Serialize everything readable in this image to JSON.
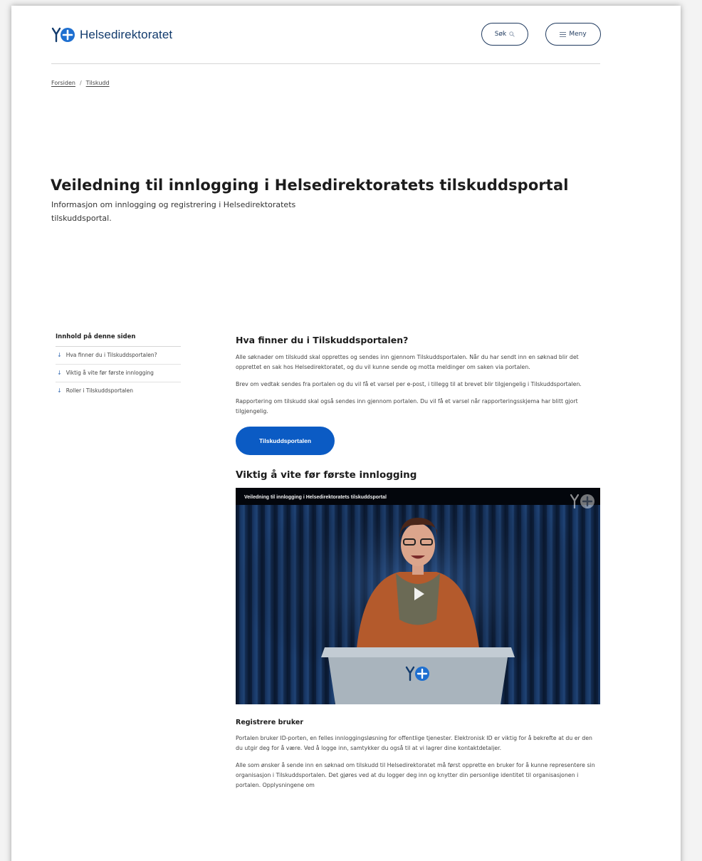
{
  "header": {
    "logo_text": "Helsedirektoratet",
    "search_label": "Søk",
    "menu_label": "Meny"
  },
  "breadcrumb": {
    "items": [
      "Forsiden",
      "Tilskudd"
    ],
    "separator": "/"
  },
  "page": {
    "title": "Veiledning til innlogging i Helsedirektoratets tilskuddsportal",
    "lead": "Informasjon om innlogging og registrering i Helsedirektoratets tilskuddsportal."
  },
  "toc": {
    "heading": "Innhold på denne siden",
    "items": [
      "Hva finner du i Tilskuddsportalen?",
      "Viktig å vite før første innlogging",
      "Roller i Tilskuddsportalen"
    ]
  },
  "section1": {
    "heading": "Hva finner du i Tilskuddsportalen?",
    "paragraphs": [
      "Alle søknader om tilskudd skal opprettes og sendes inn gjennom Tilskuddsportalen. Når du har sendt inn en søknad blir det opprettet en sak hos Helsedirektoratet, og du vil kunne sende og motta meldinger om saken via portalen.",
      "Brev om vedtak sendes fra portalen og du vil få et varsel per e-post, i tillegg til at brevet blir tilgjengelig i Tilskuddsportalen.",
      "Rapportering om tilskudd skal også sendes inn gjennom portalen. Du vil få et varsel når rapporteringsskjema har blitt gjort tilgjengelig."
    ],
    "button_label": "Tilskuddsportalen"
  },
  "section2": {
    "heading": "Viktig å vite før første innlogging",
    "video_title": "Veiledning til innlogging i Helsedirektoratets tilskuddsportal"
  },
  "section3": {
    "heading": "Registrere bruker",
    "paragraphs": [
      "Portalen bruker ID-porten, en felles innloggingsløsning for offentlige tjenester. Elektronisk ID er viktig for å bekrefte at du er den du utgir deg for å være. Ved å logge inn, samtykker du også til at vi lagrer dine kontaktdetaljer.",
      "Alle som ønsker å sende inn en søknad om tilskudd til Helsedirektoratet må først opprette en bruker for å kunne representere sin organisasjon i Tilskuddsportalen. Det gjøres ved at du logger deg inn og knytter din personlige identitet til organisasjonen i portalen. Opplysningene om"
    ]
  },
  "icons": {
    "search": "search-icon",
    "menu": "menu-icon",
    "toc_arrow": "arrow-down-icon",
    "logo": "helsedirektoratet-logo-icon",
    "play": "play-icon"
  },
  "colors": {
    "brand_dark": "#123b6d",
    "brand_blue": "#0b5bc4",
    "accent_blue": "#3b6fb4"
  }
}
